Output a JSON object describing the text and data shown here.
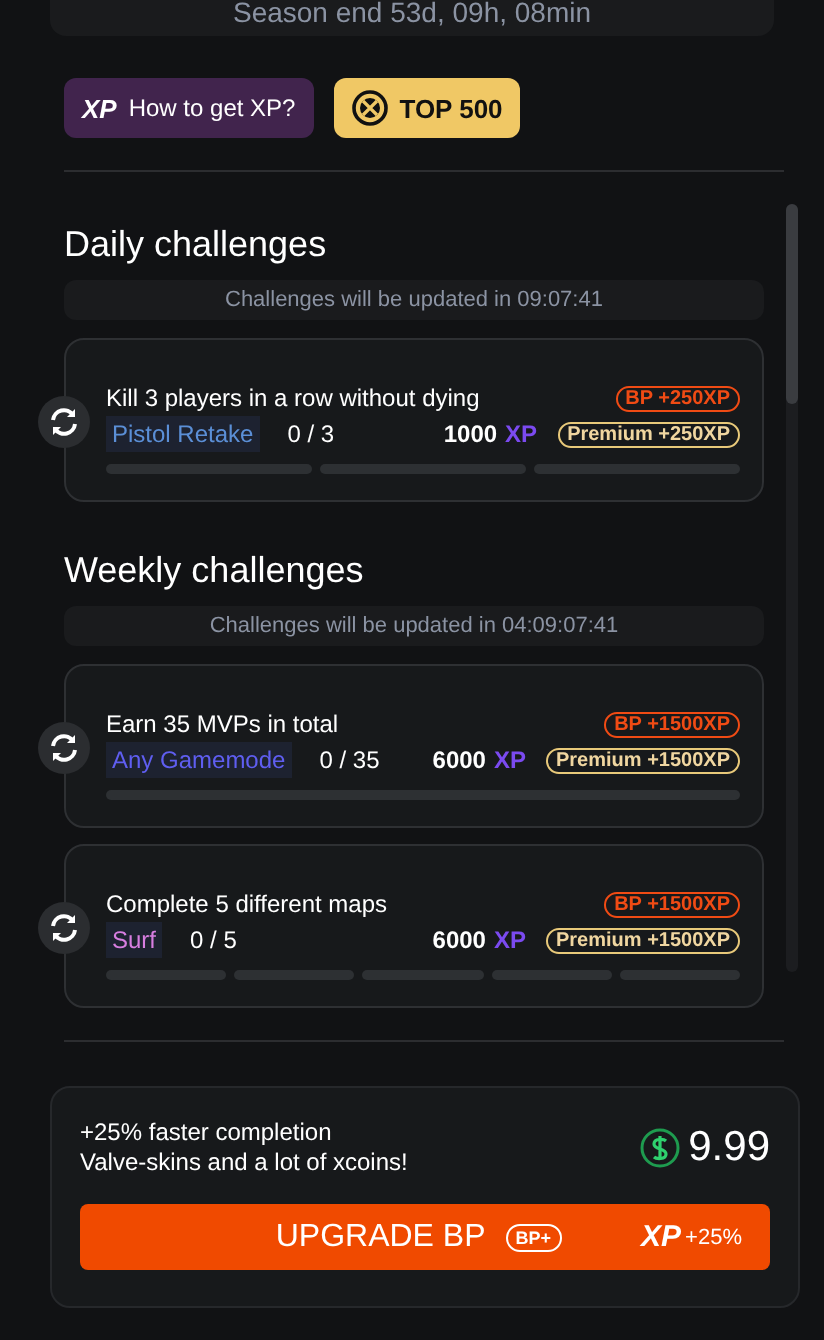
{
  "season": {
    "text": "Season end 53d,  09h,  08min"
  },
  "buttons": [
    {
      "kind": "xp",
      "icon_text": "XP",
      "label": "How to get XP?"
    },
    {
      "kind": "top",
      "label": "TOP 500"
    }
  ],
  "sections": [
    {
      "title": "Daily challenges",
      "update_text": "Challenges will be updated in 09:07:41",
      "challenges": [
        {
          "title": "Kill 3 players in a row without dying",
          "mode": "Pistol Retake",
          "color": "#5b8fd6",
          "progress": "0 / 3",
          "reward": "1000",
          "reward_unit": "XP",
          "bp": "BP +250XP",
          "premium": "Premium +250XP",
          "segments": [
            {
              "level": 0
            },
            {
              "level": 0
            },
            {
              "level": 0
            }
          ]
        }
      ]
    },
    {
      "title": "Weekly challenges",
      "update_text": "Challenges will be updated in 04:09:07:41",
      "challenges": [
        {
          "title": "Earn 35 MVPs in total",
          "mode": "Any Gamemode",
          "color": "#5f5ef0",
          "progress": "0 / 35",
          "reward": "6000",
          "reward_unit": "XP",
          "bp": "BP +1500XP",
          "premium": "Premium +1500XP",
          "segments": [
            {
              "level": 0
            }
          ]
        },
        {
          "title": "Complete 5 different maps",
          "mode": "Surf",
          "color": "#d77ee0",
          "progress": "0 / 5",
          "reward": "6000",
          "reward_unit": "XP",
          "bp": "BP +1500XP",
          "premium": "Premium +1500XP",
          "segments": [
            {
              "level": 0
            },
            {
              "level": 0
            },
            {
              "level": 0
            },
            {
              "level": 0
            },
            {
              "level": 0
            }
          ]
        }
      ]
    }
  ],
  "upgrade": {
    "lines": [
      "+25% faster completion",
      "Valve-skins and a lot of xcoins!"
    ],
    "price": "9.99",
    "button_label": "UPGRADE BP",
    "button_badge": "BP+",
    "xp_text": "XP",
    "xp_bonus": "+25%"
  }
}
